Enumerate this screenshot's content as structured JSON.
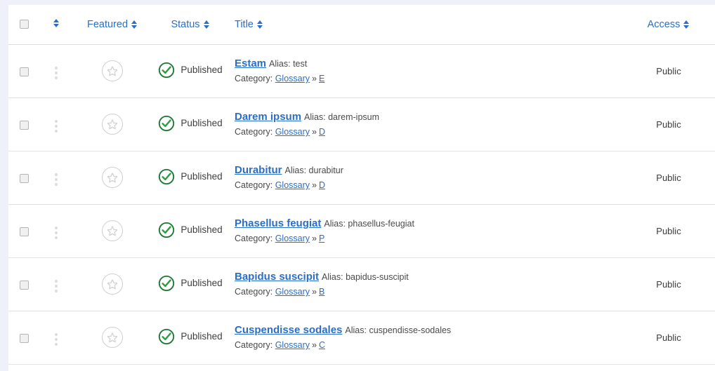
{
  "theme": {
    "page_bg": "#eef1f9",
    "surface": "#ffffff",
    "link": "#2a6ec9",
    "text": "#3c3c3c",
    "muted": "#4a4a4a",
    "border": "#e3e3e3",
    "status_green": "#1f7a36",
    "star_grey": "#cfcfcf"
  },
  "table": {
    "header": {
      "select_all": {
        "name": "check-all-toggle",
        "checked": false
      },
      "ordering": {
        "label": "",
        "icon": "sort-arrows-icon"
      },
      "columns": [
        {
          "key": "featured",
          "label": "Featured",
          "sortable": true
        },
        {
          "key": "status",
          "label": "Status",
          "sortable": true
        },
        {
          "key": "title",
          "label": "Title",
          "sortable": true
        },
        {
          "key": "access",
          "label": "Access",
          "sortable": true
        }
      ]
    },
    "rows": [
      {
        "checked": false,
        "drag_icon": "drag-handle-icon",
        "featured": {
          "icon": "star-outline-icon",
          "featured": false
        },
        "status": {
          "icon": "published-check-icon",
          "label": "Published"
        },
        "title": "Estam",
        "alias_label": "Alias:",
        "alias": "test",
        "category_label": "Category:",
        "category": "Glossary",
        "category_separator": "»",
        "subcategory": "E",
        "access": "Public"
      },
      {
        "checked": false,
        "drag_icon": "drag-handle-icon",
        "featured": {
          "icon": "star-outline-icon",
          "featured": false
        },
        "status": {
          "icon": "published-check-icon",
          "label": "Published"
        },
        "title": "Darem ipsum",
        "alias_label": "Alias:",
        "alias": "darem-ipsum",
        "category_label": "Category:",
        "category": "Glossary",
        "category_separator": "»",
        "subcategory": "D",
        "access": "Public"
      },
      {
        "checked": false,
        "drag_icon": "drag-handle-icon",
        "featured": {
          "icon": "star-outline-icon",
          "featured": false
        },
        "status": {
          "icon": "published-check-icon",
          "label": "Published"
        },
        "title": "Durabitur",
        "alias_label": "Alias:",
        "alias": "durabitur",
        "category_label": "Category:",
        "category": "Glossary",
        "category_separator": "»",
        "subcategory": "D",
        "access": "Public"
      },
      {
        "checked": false,
        "drag_icon": "drag-handle-icon",
        "featured": {
          "icon": "star-outline-icon",
          "featured": false
        },
        "status": {
          "icon": "published-check-icon",
          "label": "Published"
        },
        "title": "Phasellus feugiat",
        "alias_label": "Alias:",
        "alias": "phasellus-feugiat",
        "category_label": "Category:",
        "category": "Glossary",
        "category_separator": "»",
        "subcategory": "P",
        "access": "Public"
      },
      {
        "checked": false,
        "drag_icon": "drag-handle-icon",
        "featured": {
          "icon": "star-outline-icon",
          "featured": false
        },
        "status": {
          "icon": "published-check-icon",
          "label": "Published"
        },
        "title": "Bapidus suscipit",
        "alias_label": "Alias:",
        "alias": "bapidus-suscipit",
        "category_label": "Category:",
        "category": "Glossary",
        "category_separator": "»",
        "subcategory": "B",
        "access": "Public"
      },
      {
        "checked": false,
        "drag_icon": "drag-handle-icon",
        "featured": {
          "icon": "star-outline-icon",
          "featured": false
        },
        "status": {
          "icon": "published-check-icon",
          "label": "Published"
        },
        "title": "Cuspendisse sodales",
        "alias_label": "Alias:",
        "alias": "cuspendisse-sodales",
        "category_label": "Category:",
        "category": "Glossary",
        "category_separator": "»",
        "subcategory": "C",
        "access": "Public"
      }
    ]
  }
}
